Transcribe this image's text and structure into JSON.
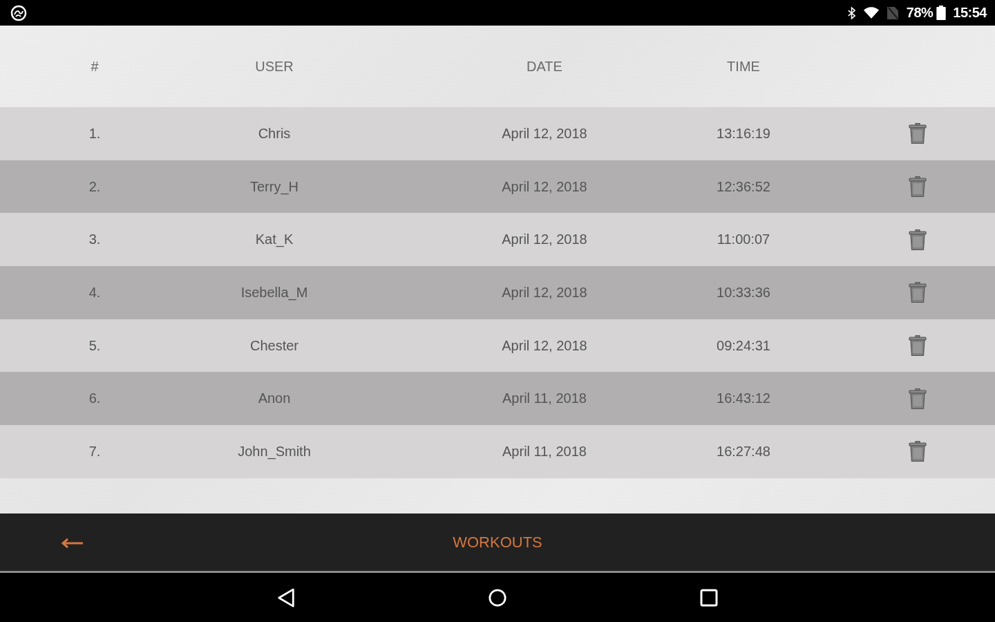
{
  "status_bar": {
    "battery": "78%",
    "time": "15:54"
  },
  "table": {
    "columns": [
      "#",
      "USER",
      "DATE",
      "TIME"
    ],
    "rows": [
      {
        "number": "1.",
        "user": "Chris",
        "date": "April 12, 2018",
        "time": "13:16:19"
      },
      {
        "number": "2.",
        "user": "Terry_H",
        "date": "April 12, 2018",
        "time": "12:36:52"
      },
      {
        "number": "3.",
        "user": "Kat_K",
        "date": "April 12, 2018",
        "time": "11:00:07"
      },
      {
        "number": "4.",
        "user": "Isebella_M",
        "date": "April 12, 2018",
        "time": "10:33:36"
      },
      {
        "number": "5.",
        "user": "Chester",
        "date": "April 12, 2018",
        "time": "09:24:31"
      },
      {
        "number": "6.",
        "user": "Anon",
        "date": "April 11, 2018",
        "time": "16:43:12"
      },
      {
        "number": "7.",
        "user": "John_Smith",
        "date": "April 11, 2018",
        "time": "16:27:48"
      }
    ]
  },
  "bottom_bar": {
    "title": "WORKOUTS"
  }
}
